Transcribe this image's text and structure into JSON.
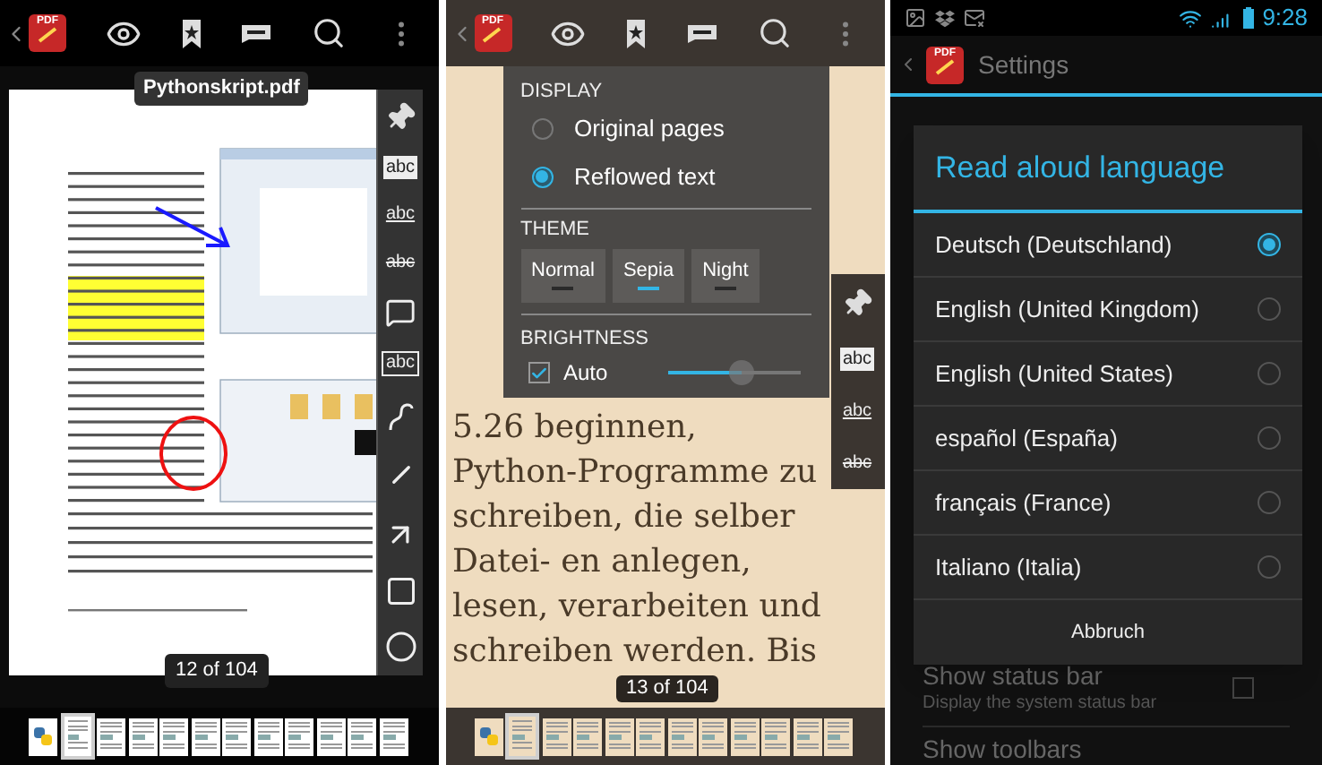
{
  "pdf_view": {
    "toolbar": {
      "app_icon_text": "PDF"
    },
    "file_title": "Pythonskript.pdf",
    "annotation_tools": [
      {
        "kind": "pin"
      },
      {
        "kind": "highlight",
        "label": "abc"
      },
      {
        "kind": "underline",
        "label": "abc"
      },
      {
        "kind": "strike",
        "label": "abc"
      },
      {
        "kind": "note"
      },
      {
        "kind": "box",
        "label": "abc"
      },
      {
        "kind": "freehand"
      },
      {
        "kind": "line"
      },
      {
        "kind": "arrow"
      },
      {
        "kind": "rect"
      },
      {
        "kind": "oval"
      }
    ],
    "page_indicator": "12 of 104",
    "thumbnails": [
      {
        "kind": "cover",
        "selected": false
      },
      {
        "kind": "page",
        "selected": true
      },
      {
        "kind": "page",
        "selected": false
      },
      {
        "kind": "page",
        "selected": false
      },
      {
        "kind": "page",
        "selected": false
      },
      {
        "kind": "page",
        "selected": false
      },
      {
        "kind": "page",
        "selected": false
      },
      {
        "kind": "page",
        "selected": false
      },
      {
        "kind": "page",
        "selected": false
      },
      {
        "kind": "page",
        "selected": false
      },
      {
        "kind": "page",
        "selected": false
      },
      {
        "kind": "page",
        "selected": false
      }
    ]
  },
  "reflow_view": {
    "toolbar": {
      "app_icon_text": "PDF"
    },
    "display_menu": {
      "display_header": "DISPLAY",
      "modes": [
        {
          "label": "Original pages",
          "selected": false
        },
        {
          "label": "Reflowed text",
          "selected": true
        }
      ],
      "theme_header": "THEME",
      "themes": [
        {
          "label": "Normal",
          "selected": false
        },
        {
          "label": "Sepia",
          "selected": true
        },
        {
          "label": "Night",
          "selected": false
        }
      ],
      "brightness_header": "BRIGHTNESS",
      "auto": {
        "label": "Auto",
        "checked": true
      },
      "brightness": {
        "level": 0.55
      }
    },
    "annotation_tools": [
      {
        "kind": "pin"
      },
      {
        "kind": "highlight",
        "label": "abc"
      },
      {
        "kind": "underline",
        "label": "abc"
      },
      {
        "kind": "strike",
        "label": "abc"
      }
    ],
    "text_lines": [
      "5.26 beginnen,",
      "Python-Programme zu",
      "schreiben, die selber",
      "Datei- en anlegen,",
      "lesen, verarbeiten und",
      "schreiben werden. Bis"
    ],
    "page_indicator": "13 of 104",
    "thumbnails": [
      {
        "kind": "cover",
        "selected": false
      },
      {
        "kind": "page",
        "selected": true
      },
      {
        "kind": "page",
        "selected": false
      },
      {
        "kind": "page",
        "selected": false
      },
      {
        "kind": "page",
        "selected": false
      },
      {
        "kind": "page",
        "selected": false
      },
      {
        "kind": "page",
        "selected": false
      },
      {
        "kind": "page",
        "selected": false
      },
      {
        "kind": "page",
        "selected": false
      },
      {
        "kind": "page",
        "selected": false
      },
      {
        "kind": "page",
        "selected": false
      },
      {
        "kind": "page",
        "selected": false
      }
    ]
  },
  "settings_view": {
    "status_bar": {
      "time": "9:28"
    },
    "toolbar": {
      "app_icon_text": "PDF"
    },
    "title": "Settings",
    "dialog": {
      "title": "Read aloud language",
      "options": [
        {
          "label": "Deutsch (Deutschland)",
          "selected": true
        },
        {
          "label": "English (United Kingdom)",
          "selected": false
        },
        {
          "label": "English (United States)",
          "selected": false
        },
        {
          "label": "español (España)",
          "selected": false
        },
        {
          "label": "français (France)",
          "selected": false
        },
        {
          "label": "Italiano (Italia)",
          "selected": false
        }
      ],
      "cancel": "Abbruch"
    },
    "settings": [
      {
        "title": "Show status bar",
        "subtitle": "Display the system status bar",
        "checked": false
      },
      {
        "title": "Show toolbars"
      }
    ]
  }
}
